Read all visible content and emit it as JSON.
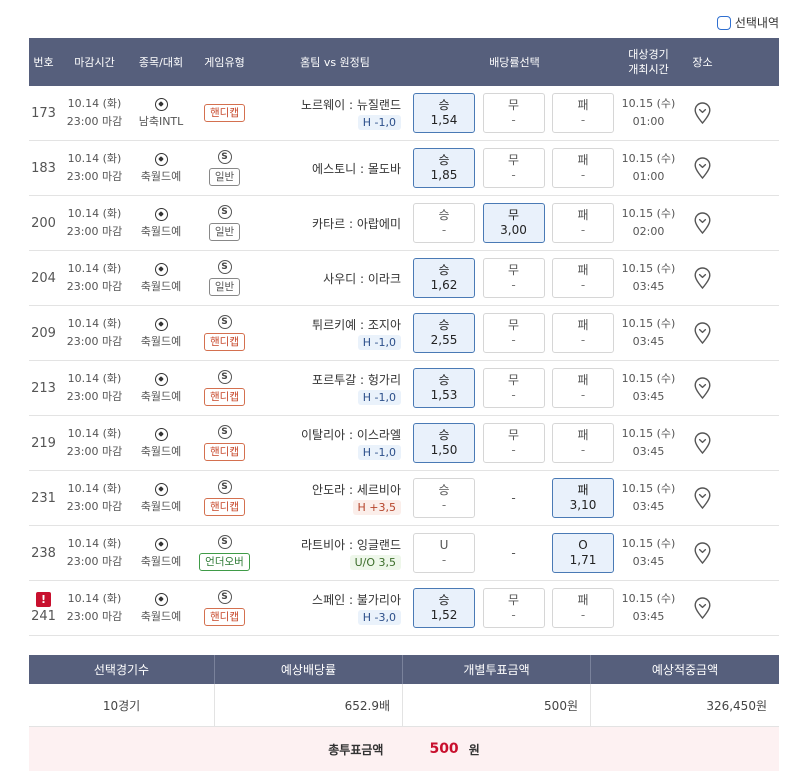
{
  "topbar": {
    "selection_label": "선택내역"
  },
  "table": {
    "headers": {
      "num": "번호",
      "deadline": "마감시간",
      "sport": "종목/대회",
      "type": "게임유형",
      "match": "홈팀 vs 원정팀",
      "odds": "배당률선택",
      "time_line1": "대상경기",
      "time_line2": "개최시간",
      "place": "장소"
    },
    "rows": [
      {
        "num": "173",
        "date": "10.14 (화)",
        "close": "23:00 마감",
        "league": "남축INTL",
        "s_icon": "",
        "type": "핸디캡",
        "type_kind": "handicap",
        "match": "노르웨이 : 뉴질랜드",
        "hcap": "H -1,0",
        "o1_label": "승",
        "o1_val": "1,54",
        "o1_sel": true,
        "o2_label": "무",
        "o2_val": "-",
        "o2_sel": false,
        "o3_label": "패",
        "o3_val": "-",
        "o3_sel": false,
        "mdate": "10.15 (수)",
        "mtime": "01:00"
      },
      {
        "num": "183",
        "date": "10.14 (화)",
        "close": "23:00 마감",
        "league": "축월드예",
        "s_icon": "S",
        "type": "일반",
        "type_kind": "normal",
        "match": "에스토니 : 몰도바",
        "hcap": "",
        "o1_label": "승",
        "o1_val": "1,85",
        "o1_sel": true,
        "o2_label": "무",
        "o2_val": "-",
        "o2_sel": false,
        "o3_label": "패",
        "o3_val": "-",
        "o3_sel": false,
        "mdate": "10.15 (수)",
        "mtime": "01:00"
      },
      {
        "num": "200",
        "date": "10.14 (화)",
        "close": "23:00 마감",
        "league": "축월드예",
        "s_icon": "S",
        "type": "일반",
        "type_kind": "normal",
        "match": "카타르 : 아랍에미",
        "hcap": "",
        "o1_label": "승",
        "o1_val": "-",
        "o1_sel": false,
        "o2_label": "무",
        "o2_val": "3,00",
        "o2_sel": true,
        "o3_label": "패",
        "o3_val": "-",
        "o3_sel": false,
        "mdate": "10.15 (수)",
        "mtime": "02:00"
      },
      {
        "num": "204",
        "date": "10.14 (화)",
        "close": "23:00 마감",
        "league": "축월드예",
        "s_icon": "S",
        "type": "일반",
        "type_kind": "normal",
        "match": "사우디 : 이라크",
        "hcap": "",
        "o1_label": "승",
        "o1_val": "1,62",
        "o1_sel": true,
        "o2_label": "무",
        "o2_val": "-",
        "o2_sel": false,
        "o3_label": "패",
        "o3_val": "-",
        "o3_sel": false,
        "mdate": "10.15 (수)",
        "mtime": "03:45"
      },
      {
        "num": "209",
        "date": "10.14 (화)",
        "close": "23:00 마감",
        "league": "축월드예",
        "s_icon": "S",
        "type": "핸디캡",
        "type_kind": "handicap",
        "match": "튀르키예 : 조지아",
        "hcap": "H -1,0",
        "o1_label": "승",
        "o1_val": "2,55",
        "o1_sel": true,
        "o2_label": "무",
        "o2_val": "-",
        "o2_sel": false,
        "o3_label": "패",
        "o3_val": "-",
        "o3_sel": false,
        "mdate": "10.15 (수)",
        "mtime": "03:45"
      },
      {
        "num": "213",
        "date": "10.14 (화)",
        "close": "23:00 마감",
        "league": "축월드예",
        "s_icon": "S",
        "type": "핸디캡",
        "type_kind": "handicap",
        "match": "포르투갈 : 헝가리",
        "hcap": "H -1,0",
        "o1_label": "승",
        "o1_val": "1,53",
        "o1_sel": true,
        "o2_label": "무",
        "o2_val": "-",
        "o2_sel": false,
        "o3_label": "패",
        "o3_val": "-",
        "o3_sel": false,
        "mdate": "10.15 (수)",
        "mtime": "03:45"
      },
      {
        "num": "219",
        "date": "10.14 (화)",
        "close": "23:00 마감",
        "league": "축월드예",
        "s_icon": "S",
        "type": "핸디캡",
        "type_kind": "handicap",
        "match": "이탈리아 : 이스라엘",
        "hcap": "H -1,0",
        "o1_label": "승",
        "o1_val": "1,50",
        "o1_sel": true,
        "o2_label": "무",
        "o2_val": "-",
        "o2_sel": false,
        "o3_label": "패",
        "o3_val": "-",
        "o3_sel": false,
        "mdate": "10.15 (수)",
        "mtime": "03:45"
      },
      {
        "num": "231",
        "date": "10.14 (화)",
        "close": "23:00 마감",
        "league": "축월드예",
        "s_icon": "S",
        "type": "핸디캡",
        "type_kind": "handicap",
        "match": "안도라 : 세르비아",
        "hcap": "H +3,5",
        "o1_label": "승",
        "o1_val": "-",
        "o1_sel": false,
        "o2_label": "",
        "o2_val": "-",
        "o2_sel": false,
        "o2_plain": true,
        "o3_label": "패",
        "o3_val": "3,10",
        "o3_sel": true,
        "mdate": "10.15 (수)",
        "mtime": "03:45"
      },
      {
        "num": "238",
        "date": "10.14 (화)",
        "close": "23:00 마감",
        "league": "축월드예",
        "s_icon": "S",
        "type": "언더오버",
        "type_kind": "ou",
        "match": "라트비아 : 잉글랜드",
        "hcap": "U/O 3,5",
        "o1_label": "U",
        "o1_val": "-",
        "o1_sel": false,
        "o2_label": "",
        "o2_val": "-",
        "o2_sel": false,
        "o2_plain": true,
        "o3_label": "O",
        "o3_val": "1,71",
        "o3_sel": true,
        "mdate": "10.15 (수)",
        "mtime": "03:45"
      },
      {
        "num": "241",
        "warn": "!",
        "date": "10.14 (화)",
        "close": "23:00 마감",
        "league": "축월드예",
        "s_icon": "S",
        "type": "핸디캡",
        "type_kind": "handicap",
        "match": "스페인 : 불가리아",
        "hcap": "H -3,0",
        "o1_label": "승",
        "o1_val": "1,52",
        "o1_sel": true,
        "o2_label": "무",
        "o2_val": "-",
        "o2_sel": false,
        "o3_label": "패",
        "o3_val": "-",
        "o3_sel": false,
        "mdate": "10.15 (수)",
        "mtime": "03:45"
      }
    ]
  },
  "summary": {
    "headers": [
      "선택경기수",
      "예상배당률",
      "개별투표금액",
      "예상적중금액"
    ],
    "values": [
      "10경기",
      "652.9배",
      "500원",
      "326,450원"
    ],
    "total_label": "총투표금액",
    "total_value": "500",
    "total_unit": "원"
  },
  "colors": {
    "header_bg": "#565f7c",
    "selected_bg": "#e9f1fb",
    "selected_border": "#4a7ab5",
    "handicap_tag": "#c7472a",
    "ou_tag": "#2d7a35",
    "total_value": "#c8102e",
    "total_bg": "#fdf1f2"
  },
  "icons": {
    "soccer": "soccer-ball-icon",
    "pin": "map-pin-icon",
    "s_badge": "s-circle-icon",
    "warn": "warning-icon"
  }
}
